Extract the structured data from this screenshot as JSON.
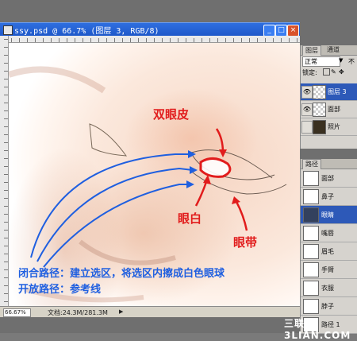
{
  "window": {
    "title": "ssy.psd @ 66.7% (图层 3, RGB/8)",
    "minimize": "_",
    "maximize": "□",
    "close": "×"
  },
  "status": {
    "zoom": "66.67%",
    "doc_size": "文档:24.3M/281.3M",
    "arrow": "▶"
  },
  "layers_panel": {
    "tabs": [
      "图层",
      "通道"
    ],
    "blend_mode": "正常",
    "opacity_label": "不",
    "lock_label": "锁定:",
    "layers": [
      {
        "name": "图层 3",
        "selected": true,
        "visible": true
      },
      {
        "name": "面部",
        "selected": false,
        "visible": true
      },
      {
        "name": "照片",
        "selected": false,
        "visible": false
      }
    ]
  },
  "paths_panel": {
    "title": "路径",
    "items": [
      {
        "name": "面部",
        "selected": false
      },
      {
        "name": "鼻子",
        "selected": false
      },
      {
        "name": "眼睛",
        "selected": true
      },
      {
        "name": "嘴唇",
        "selected": false
      },
      {
        "name": "眉毛",
        "selected": false
      },
      {
        "name": "手臂",
        "selected": false
      },
      {
        "name": "衣服",
        "selected": false
      },
      {
        "name": "脖子",
        "selected": false
      },
      {
        "name": "路径 1",
        "selected": false
      }
    ]
  },
  "annotations": {
    "double_eyelid": "双眼皮",
    "eye_white": "眼白",
    "eye_bag": "眼带",
    "closed_path_note": "闭合路径：建立选区，将选区内擦成白色眼球",
    "open_path_note": "开放路径：参考线"
  },
  "watermark": "三联网 3LIAN.COM",
  "colors": {
    "annotation_red": "#e11c1c",
    "annotation_blue": "#1f5fe0",
    "titlebar_blue": "#1d57c8",
    "selected_row": "#2d59b8"
  }
}
